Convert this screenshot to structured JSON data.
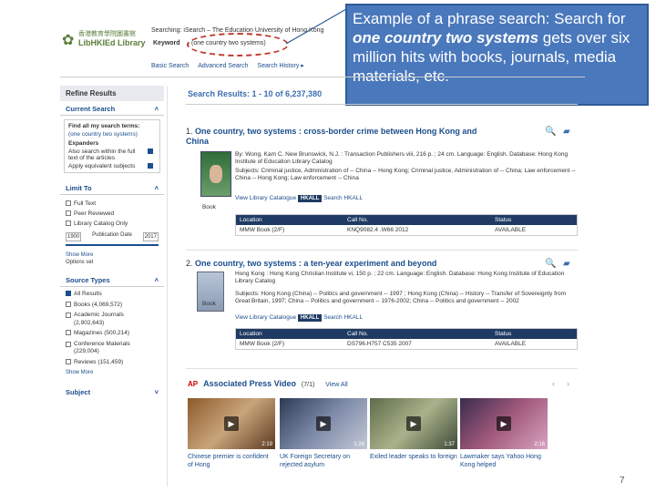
{
  "header": {
    "logo_cn": "香港教育學院圖書館",
    "logo_en": "LibHKIEd Library",
    "searching_label": "Searching:",
    "searching_value": "iSearch – The Education University of Hong Kong",
    "keyword_label": "Keyword",
    "query": "(one country two systems)",
    "links": [
      "Basic Search",
      "Advanced Search",
      "Search History ▸"
    ]
  },
  "callout": {
    "line1_prefix": "Example of a phrase search: Search for ",
    "line1_em": "one country two systems",
    "line2": "gets over six million hits with books, journals, media materials, etc."
  },
  "sidebar": {
    "refine": "Refine Results",
    "current_search": "Current Search",
    "find_all": "Find all my search terms:",
    "term": "(one country two systems)",
    "expanders": "Expanders",
    "exp1": "Also search within the full text of the articles",
    "exp2": "Apply equivalent subjects",
    "limit_to": "Limit To",
    "limits": [
      "Full Text",
      "Peer Reviewed",
      "Library Catalog Only"
    ],
    "pub_from": "1900",
    "pub_label": "Publication Date",
    "pub_to": "2017",
    "show_more": "Show More",
    "options_set": "Options set",
    "source_types": "Source Types",
    "sources": [
      {
        "label": "All Results",
        "checked": true
      },
      {
        "label": "Books (4,069,572)",
        "checked": false
      },
      {
        "label": "Academic Journals (2,902,643)",
        "checked": false
      },
      {
        "label": "Magazines (500,214)",
        "checked": false
      },
      {
        "label": "Conference Materials (229,004)",
        "checked": false
      },
      {
        "label": "Reviews (151,459)",
        "checked": false
      }
    ],
    "show_more2": "Show More",
    "subject": "Subject"
  },
  "results": {
    "summary": "Search Results: 1 - 10 of 6,237,380",
    "items": [
      {
        "num": "1.",
        "title": "One country, two systems : cross-border crime between Hong Kong and China",
        "by": "By: Wong, Kam C.  New Brunswick, N.J. : Transaction Publishers viii, 216 p. ; 24 cm. Language: English. Database: Hong Kong Institute of Education Library Catalog",
        "subjects": "Subjects: Criminal justice, Administration of -- China -- Hong Kong; Criminal justice, Administration of -- China; Law enforcement -- China -- Hong Kong; Law enforcement -- China",
        "view": "View Library Catalogue",
        "badge": "HKALL",
        "search": "Search HKALL",
        "type": "Book",
        "table_head": [
          "Location",
          "Call No.",
          "Status"
        ],
        "table_row": [
          "MMW Book (2/F)",
          "KNQ9082.4 .W66 2012",
          "AVAILABLE"
        ]
      },
      {
        "num": "2.",
        "title": "One country, two systems : a ten-year experiment and beyond",
        "by": "Hong Kong : Hong Kong Christian Institute vi, 150 p. ; 22 cm. Language: English. Database: Hong Kong Institute of Education Library Catalog",
        "subjects": "Subjects: Hong Kong (China) -- Politics and government -- 1997 ; Hong Kong (China) -- History -- Transfer of Sovereignty from Great Britain, 1997; China -- Politics and government -- 1976-2002; China -- Politics and government -- 2002",
        "view": "View Library Catalogue",
        "badge": "HKALL",
        "search": "Search HKALL",
        "type": "Book",
        "table_head": [
          "Location",
          "Call No.",
          "Status"
        ],
        "table_row": [
          "MMW Book (2/F)",
          "DS796.H757 C535 2007",
          "AVAILABLE"
        ]
      }
    ],
    "ap": {
      "logo": "AP",
      "title": "Associated Press Video",
      "count": "(7/1)",
      "view_all": "View All",
      "videos": [
        {
          "dur": "2:19",
          "caption": "Chinese premier is confident of Hong"
        },
        {
          "dur": "1:24",
          "caption": "UK Foreign Secretary on rejected asylum"
        },
        {
          "dur": "1:37",
          "caption": "Exiled leader speaks to foreign"
        },
        {
          "dur": "2:16",
          "caption": "Lawmaker says Yahoo Hong Kong helped"
        }
      ]
    }
  },
  "page_number": "7"
}
